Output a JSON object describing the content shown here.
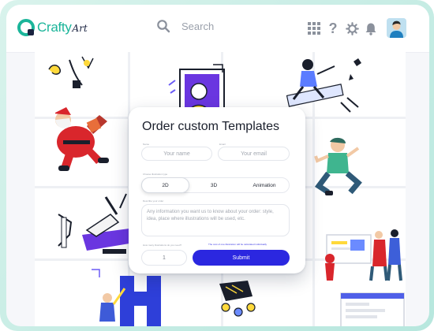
{
  "app": {
    "name_part1": "Crafty",
    "name_part2": "Art"
  },
  "header": {
    "search_placeholder": "Search",
    "icons": [
      "search-icon",
      "grid-icon",
      "help-icon",
      "settings-icon",
      "bell-icon",
      "avatar"
    ]
  },
  "modal": {
    "title": "Order custom Templates",
    "name_label": "Name",
    "name_placeholder": "Your name",
    "email_label": "Email",
    "email_placeholder": "Your email",
    "style_label": "Choose illustration type",
    "styles": [
      "2D",
      "3D",
      "Animation"
    ],
    "selected_style": "2D",
    "description_label": "Describe your order",
    "description_placeholder": "Any information you want us to know about your order: style, idea, place where illustrations will be used, etc.",
    "quantity_label": "How many illustrations do you need?",
    "quantity_value": "1",
    "note": "The cost of one illustration will be calculated individually",
    "submit_label": "Submit"
  },
  "colors": {
    "brand": "#1bb59a",
    "accent": "#2b27e0",
    "frame": "#c4ebe3"
  }
}
